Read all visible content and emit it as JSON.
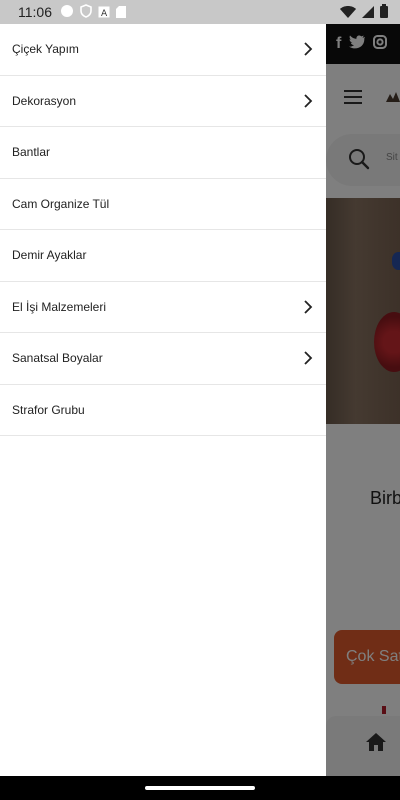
{
  "status_bar": {
    "time": "11:06",
    "left_icons": [
      "circle-icon",
      "shield-icon",
      "a-icon",
      "sd-card-icon"
    ],
    "right_icons": [
      "wifi-icon",
      "signal-icon",
      "battery-icon"
    ]
  },
  "drawer": {
    "items": [
      {
        "label": "Çiçek Yapım",
        "has_children": true
      },
      {
        "label": "Dekorasyon",
        "has_children": true
      },
      {
        "label": "Bantlar",
        "has_children": false
      },
      {
        "label": "Cam Organize Tül",
        "has_children": false
      },
      {
        "label": "Demir Ayaklar",
        "has_children": false
      },
      {
        "label": "El İşi Malzemeleri",
        "has_children": true
      },
      {
        "label": "Sanatsal Boyalar",
        "has_children": true
      },
      {
        "label": "Strafor Grubu",
        "has_children": false
      }
    ]
  },
  "background": {
    "social_icons": [
      "facebook-icon",
      "twitter-icon",
      "instagram-icon"
    ],
    "search_placeholder": "Sit",
    "heading_fragment": "Birb",
    "cta_label": "Çok Sat",
    "bottom_nav_icon": "home-icon"
  },
  "colors": {
    "accent": "#e05a2c",
    "scrim": "rgba(0,0,0,0.5)"
  }
}
